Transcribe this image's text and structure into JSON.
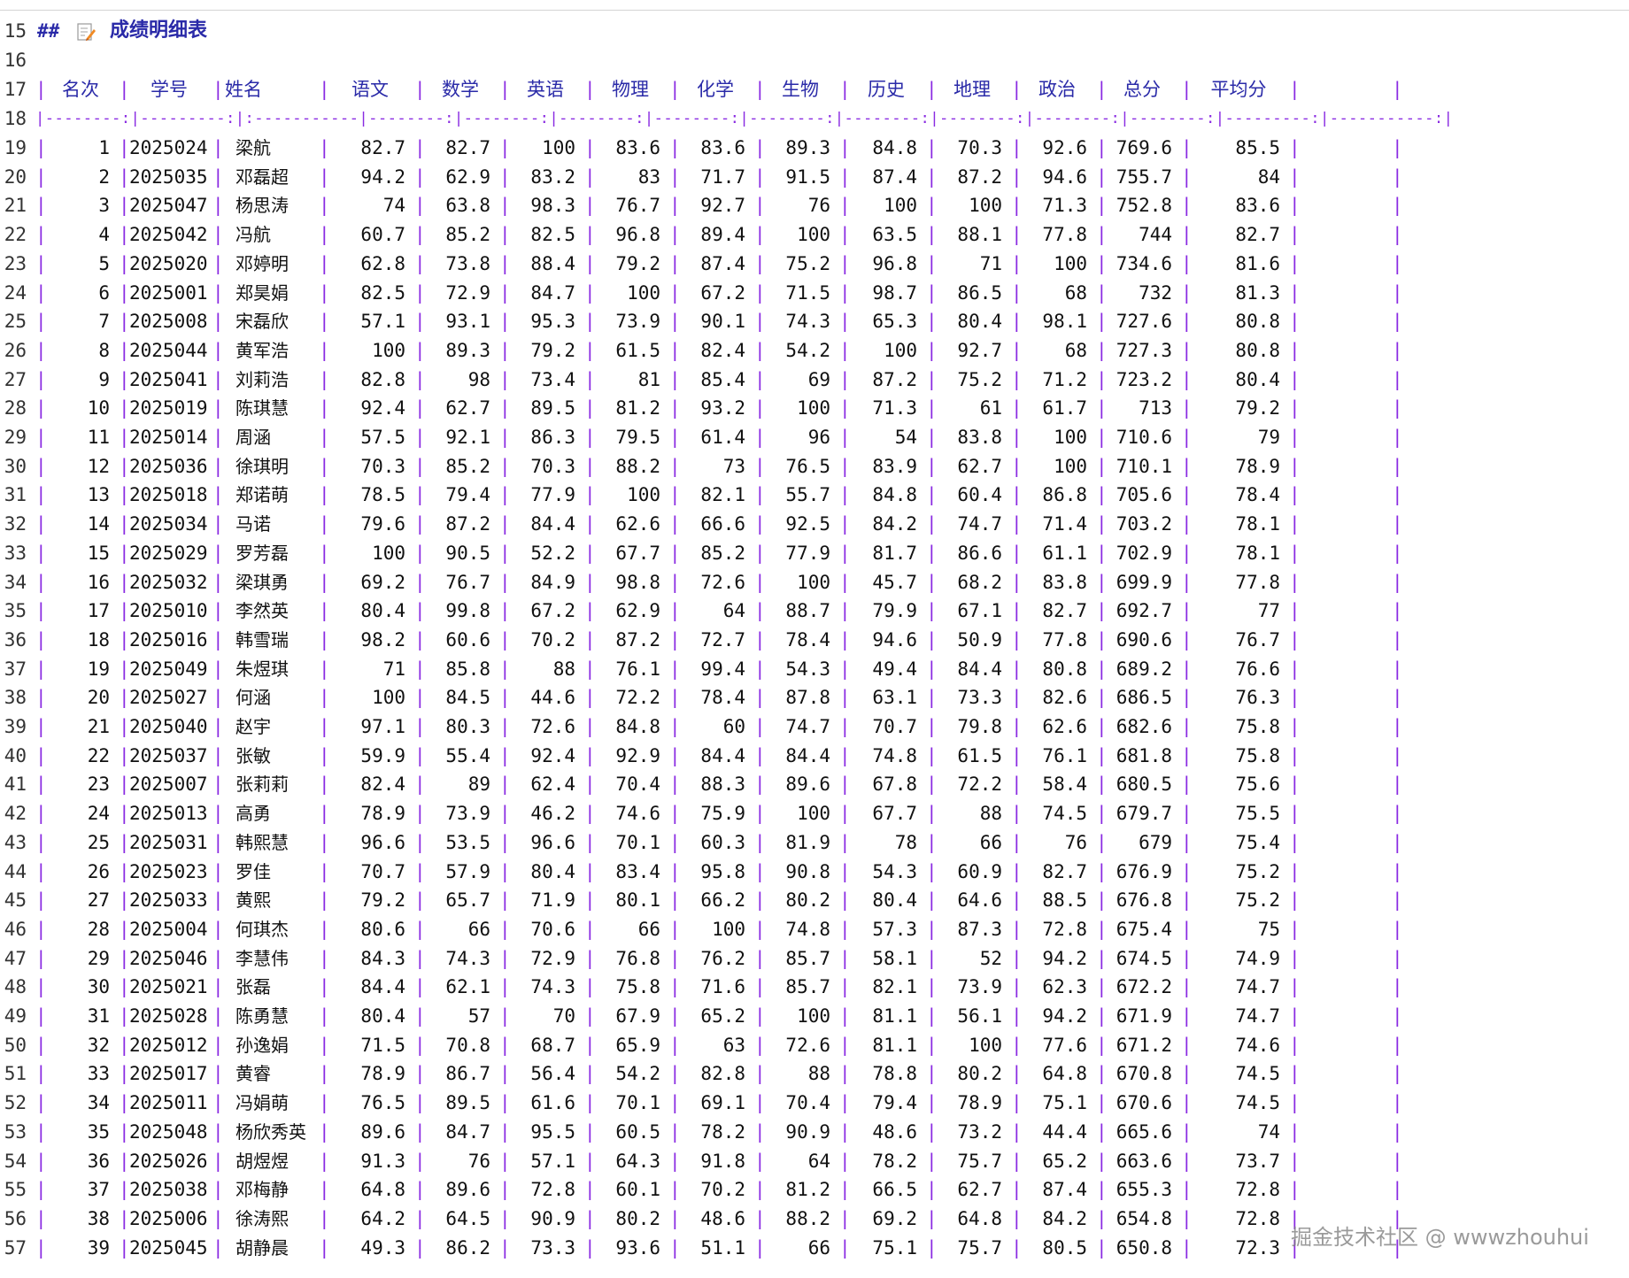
{
  "editor": {
    "first_line": 15,
    "heading": {
      "line": "15",
      "marker": "##",
      "icon": "memo-icon",
      "title": "成绩明细表"
    },
    "blank_line": "16",
    "header_line": "17",
    "separator_line": "18",
    "columns": [
      "名次",
      "学号",
      "姓名",
      "语文",
      "数学",
      "英语",
      "物理",
      "化学",
      "生物",
      "历史",
      "地理",
      "政治",
      "总分",
      "平均分"
    ],
    "separator_text": "|--------:|---------:|:-----------|--------:|--------:|--------:|--------:|--------:|--------:|--------:|--------:|--------:|---------:|-----------:|",
    "rows": [
      [
        "19",
        "1",
        "2025024",
        "梁航",
        "82.7",
        "82.7",
        "100",
        "83.6",
        "83.6",
        "89.3",
        "84.8",
        "70.3",
        "92.6",
        "769.6",
        "85.5"
      ],
      [
        "20",
        "2",
        "2025035",
        "邓磊超",
        "94.2",
        "62.9",
        "83.2",
        "83",
        "71.7",
        "91.5",
        "87.4",
        "87.2",
        "94.6",
        "755.7",
        "84"
      ],
      [
        "21",
        "3",
        "2025047",
        "杨思涛",
        "74",
        "63.8",
        "98.3",
        "76.7",
        "92.7",
        "76",
        "100",
        "100",
        "71.3",
        "752.8",
        "83.6"
      ],
      [
        "22",
        "4",
        "2025042",
        "冯航",
        "60.7",
        "85.2",
        "82.5",
        "96.8",
        "89.4",
        "100",
        "63.5",
        "88.1",
        "77.8",
        "744",
        "82.7"
      ],
      [
        "23",
        "5",
        "2025020",
        "邓婷明",
        "62.8",
        "73.8",
        "88.4",
        "79.2",
        "87.4",
        "75.2",
        "96.8",
        "71",
        "100",
        "734.6",
        "81.6"
      ],
      [
        "24",
        "6",
        "2025001",
        "郑昊娟",
        "82.5",
        "72.9",
        "84.7",
        "100",
        "67.2",
        "71.5",
        "98.7",
        "86.5",
        "68",
        "732",
        "81.3"
      ],
      [
        "25",
        "7",
        "2025008",
        "宋磊欣",
        "57.1",
        "93.1",
        "95.3",
        "73.9",
        "90.1",
        "74.3",
        "65.3",
        "80.4",
        "98.1",
        "727.6",
        "80.8"
      ],
      [
        "26",
        "8",
        "2025044",
        "黄军浩",
        "100",
        "89.3",
        "79.2",
        "61.5",
        "82.4",
        "54.2",
        "100",
        "92.7",
        "68",
        "727.3",
        "80.8"
      ],
      [
        "27",
        "9",
        "2025041",
        "刘莉浩",
        "82.8",
        "98",
        "73.4",
        "81",
        "85.4",
        "69",
        "87.2",
        "75.2",
        "71.2",
        "723.2",
        "80.4"
      ],
      [
        "28",
        "10",
        "2025019",
        "陈琪慧",
        "92.4",
        "62.7",
        "89.5",
        "81.2",
        "93.2",
        "100",
        "71.3",
        "61",
        "61.7",
        "713",
        "79.2"
      ],
      [
        "29",
        "11",
        "2025014",
        "周涵",
        "57.5",
        "92.1",
        "86.3",
        "79.5",
        "61.4",
        "96",
        "54",
        "83.8",
        "100",
        "710.6",
        "79"
      ],
      [
        "30",
        "12",
        "2025036",
        "徐琪明",
        "70.3",
        "85.2",
        "70.3",
        "88.2",
        "73",
        "76.5",
        "83.9",
        "62.7",
        "100",
        "710.1",
        "78.9"
      ],
      [
        "31",
        "13",
        "2025018",
        "郑诺萌",
        "78.5",
        "79.4",
        "77.9",
        "100",
        "82.1",
        "55.7",
        "84.8",
        "60.4",
        "86.8",
        "705.6",
        "78.4"
      ],
      [
        "32",
        "14",
        "2025034",
        "马诺",
        "79.6",
        "87.2",
        "84.4",
        "62.6",
        "66.6",
        "92.5",
        "84.2",
        "74.7",
        "71.4",
        "703.2",
        "78.1"
      ],
      [
        "33",
        "15",
        "2025029",
        "罗芳磊",
        "100",
        "90.5",
        "52.2",
        "67.7",
        "85.2",
        "77.9",
        "81.7",
        "86.6",
        "61.1",
        "702.9",
        "78.1"
      ],
      [
        "34",
        "16",
        "2025032",
        "梁琪勇",
        "69.2",
        "76.7",
        "84.9",
        "98.8",
        "72.6",
        "100",
        "45.7",
        "68.2",
        "83.8",
        "699.9",
        "77.8"
      ],
      [
        "35",
        "17",
        "2025010",
        "李然英",
        "80.4",
        "99.8",
        "67.2",
        "62.9",
        "64",
        "88.7",
        "79.9",
        "67.1",
        "82.7",
        "692.7",
        "77"
      ],
      [
        "36",
        "18",
        "2025016",
        "韩雪瑞",
        "98.2",
        "60.6",
        "70.2",
        "87.2",
        "72.7",
        "78.4",
        "94.6",
        "50.9",
        "77.8",
        "690.6",
        "76.7"
      ],
      [
        "37",
        "19",
        "2025049",
        "朱煜琪",
        "71",
        "85.8",
        "88",
        "76.1",
        "99.4",
        "54.3",
        "49.4",
        "84.4",
        "80.8",
        "689.2",
        "76.6"
      ],
      [
        "38",
        "20",
        "2025027",
        "何涵",
        "100",
        "84.5",
        "44.6",
        "72.2",
        "78.4",
        "87.8",
        "63.1",
        "73.3",
        "82.6",
        "686.5",
        "76.3"
      ],
      [
        "39",
        "21",
        "2025040",
        "赵宇",
        "97.1",
        "80.3",
        "72.6",
        "84.8",
        "60",
        "74.7",
        "70.7",
        "79.8",
        "62.6",
        "682.6",
        "75.8"
      ],
      [
        "40",
        "22",
        "2025037",
        "张敏",
        "59.9",
        "55.4",
        "92.4",
        "92.9",
        "84.4",
        "84.4",
        "74.8",
        "61.5",
        "76.1",
        "681.8",
        "75.8"
      ],
      [
        "41",
        "23",
        "2025007",
        "张莉莉",
        "82.4",
        "89",
        "62.4",
        "70.4",
        "88.3",
        "89.6",
        "67.8",
        "72.2",
        "58.4",
        "680.5",
        "75.6"
      ],
      [
        "42",
        "24",
        "2025013",
        "高勇",
        "78.9",
        "73.9",
        "46.2",
        "74.6",
        "75.9",
        "100",
        "67.7",
        "88",
        "74.5",
        "679.7",
        "75.5"
      ],
      [
        "43",
        "25",
        "2025031",
        "韩熙慧",
        "96.6",
        "53.5",
        "96.6",
        "70.1",
        "60.3",
        "81.9",
        "78",
        "66",
        "76",
        "679",
        "75.4"
      ],
      [
        "44",
        "26",
        "2025023",
        "罗佳",
        "70.7",
        "57.9",
        "80.4",
        "83.4",
        "95.8",
        "90.8",
        "54.3",
        "60.9",
        "82.7",
        "676.9",
        "75.2"
      ],
      [
        "45",
        "27",
        "2025033",
        "黄熙",
        "79.2",
        "65.7",
        "71.9",
        "80.1",
        "66.2",
        "80.2",
        "80.4",
        "64.6",
        "88.5",
        "676.8",
        "75.2"
      ],
      [
        "46",
        "28",
        "2025004",
        "何琪杰",
        "80.6",
        "66",
        "70.6",
        "66",
        "100",
        "74.8",
        "57.3",
        "87.3",
        "72.8",
        "675.4",
        "75"
      ],
      [
        "47",
        "29",
        "2025046",
        "李慧伟",
        "84.3",
        "74.3",
        "72.9",
        "76.8",
        "76.2",
        "85.7",
        "58.1",
        "52",
        "94.2",
        "674.5",
        "74.9"
      ],
      [
        "48",
        "30",
        "2025021",
        "张磊",
        "84.4",
        "62.1",
        "74.3",
        "75.8",
        "71.6",
        "85.7",
        "82.1",
        "73.9",
        "62.3",
        "672.2",
        "74.7"
      ],
      [
        "49",
        "31",
        "2025028",
        "陈勇慧",
        "80.4",
        "57",
        "70",
        "67.9",
        "65.2",
        "100",
        "81.1",
        "56.1",
        "94.2",
        "671.9",
        "74.7"
      ],
      [
        "50",
        "32",
        "2025012",
        "孙逸娟",
        "71.5",
        "70.8",
        "68.7",
        "65.9",
        "63",
        "72.6",
        "81.1",
        "100",
        "77.6",
        "671.2",
        "74.6"
      ],
      [
        "51",
        "33",
        "2025017",
        "黄睿",
        "78.9",
        "86.7",
        "56.4",
        "54.2",
        "82.8",
        "88",
        "78.8",
        "80.2",
        "64.8",
        "670.8",
        "74.5"
      ],
      [
        "52",
        "34",
        "2025011",
        "冯娟萌",
        "76.5",
        "89.5",
        "61.6",
        "70.1",
        "69.1",
        "70.4",
        "79.4",
        "78.9",
        "75.1",
        "670.6",
        "74.5"
      ],
      [
        "53",
        "35",
        "2025048",
        "杨欣秀英",
        "89.6",
        "84.7",
        "95.5",
        "60.5",
        "78.2",
        "90.9",
        "48.6",
        "73.2",
        "44.4",
        "665.6",
        "74"
      ],
      [
        "54",
        "36",
        "2025026",
        "胡煜煜",
        "91.3",
        "76",
        "57.1",
        "64.3",
        "91.8",
        "64",
        "78.2",
        "75.7",
        "65.2",
        "663.6",
        "73.7"
      ],
      [
        "55",
        "37",
        "2025038",
        "邓梅静",
        "64.8",
        "89.6",
        "72.8",
        "60.1",
        "70.2",
        "81.2",
        "66.5",
        "62.7",
        "87.4",
        "655.3",
        "72.8"
      ],
      [
        "56",
        "38",
        "2025006",
        "徐涛熙",
        "64.2",
        "64.5",
        "90.9",
        "80.2",
        "48.6",
        "88.2",
        "69.2",
        "64.8",
        "84.2",
        "654.8",
        "72.8"
      ],
      [
        "57",
        "39",
        "2025045",
        "胡静晨",
        "49.3",
        "86.2",
        "73.3",
        "93.6",
        "51.1",
        "66",
        "75.1",
        "75.7",
        "80.5",
        "650.8",
        "72.3"
      ]
    ]
  },
  "watermark": "掘金技术社区 @ wwwzhouhui",
  "colors": {
    "pipe": "#8a2be2",
    "header": "#2a2aa8",
    "text": "#111111",
    "line_number": "#333333"
  }
}
